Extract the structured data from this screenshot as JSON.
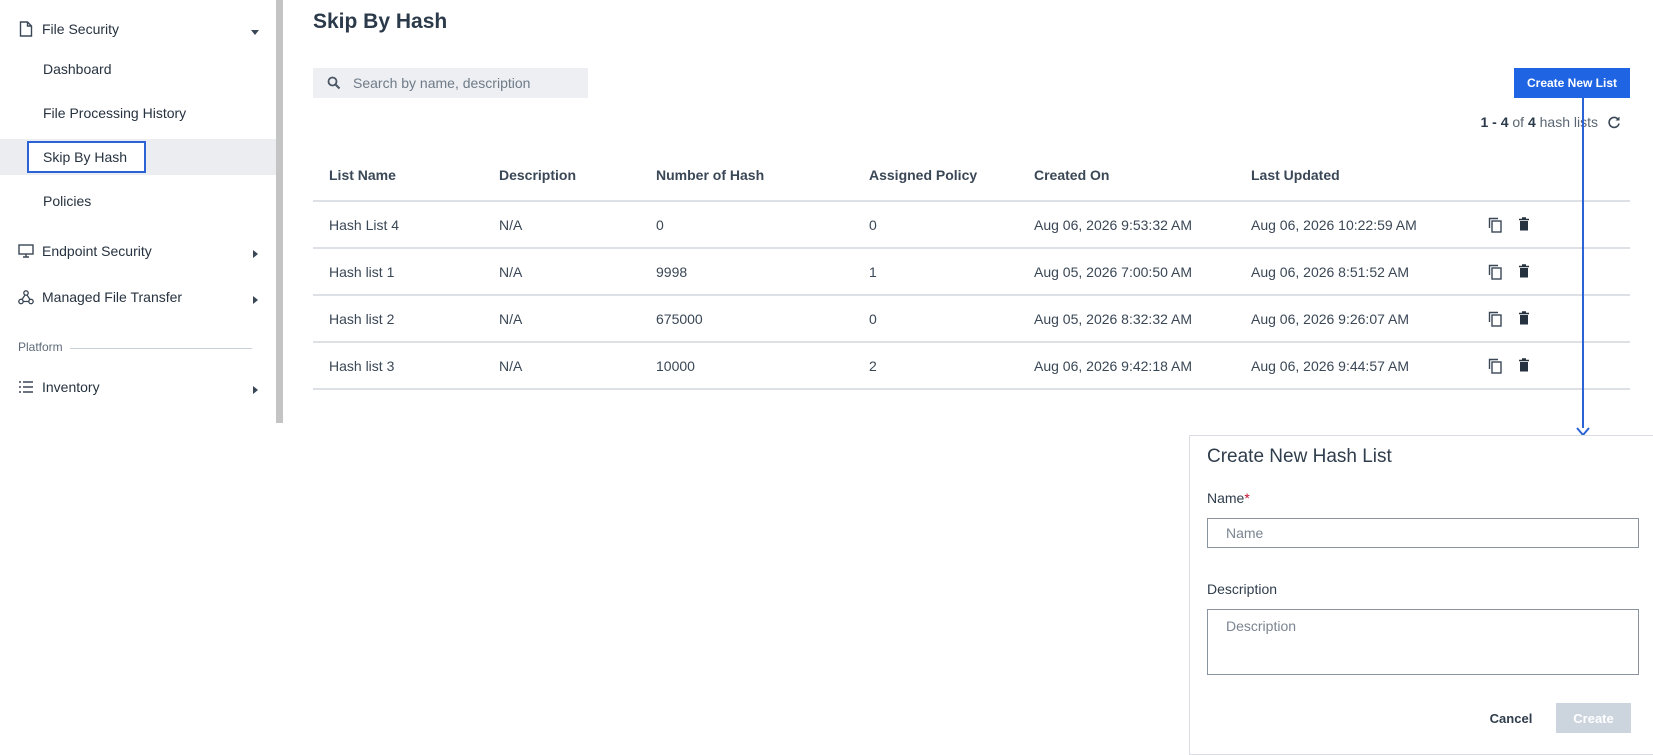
{
  "sidebar": {
    "file_security": {
      "label": "File Security",
      "icon": "file-icon"
    },
    "items": [
      {
        "label": "Dashboard"
      },
      {
        "label": "File Processing History"
      },
      {
        "label": "Skip By Hash",
        "active": true
      },
      {
        "label": "Policies"
      }
    ],
    "endpoint_security": {
      "label": "Endpoint Security",
      "icon": "monitor-icon"
    },
    "managed_file_transfer": {
      "label": "Managed File Transfer",
      "icon": "share-nodes-icon"
    },
    "section_platform": "Platform",
    "inventory": {
      "label": "Inventory",
      "icon": "list-icon"
    }
  },
  "main": {
    "title": "Skip By Hash",
    "search": {
      "placeholder": "Search by name, description",
      "value": ""
    },
    "create_button": "Create New List",
    "count": {
      "range": "1 - 4",
      "of_text": "of",
      "total": "4",
      "suffix": "hash lists"
    },
    "table": {
      "columns": [
        "List Name",
        "Description",
        "Number of Hash",
        "Assigned Policy",
        "Created On",
        "Last Updated",
        ""
      ],
      "rows": [
        {
          "name": "Hash List 4",
          "description": "N/A",
          "hash_count": "0",
          "policy": "0",
          "created": "Aug 06, 2026 9:53:32 AM",
          "updated": "Aug 06, 2026 10:22:59 AM"
        },
        {
          "name": "Hash list 1",
          "description": "N/A",
          "hash_count": "9998",
          "policy": "1",
          "created": "Aug 05, 2026 7:00:50 AM",
          "updated": "Aug 06, 2026 8:51:52 AM"
        },
        {
          "name": "Hash list 2",
          "description": "N/A",
          "hash_count": "675000",
          "policy": "0",
          "created": "Aug 05, 2026 8:32:32 AM",
          "updated": "Aug 06, 2026 9:26:07 AM"
        },
        {
          "name": "Hash list 3",
          "description": "N/A",
          "hash_count": "10000",
          "policy": "2",
          "created": "Aug 06, 2026 9:42:18 AM",
          "updated": "Aug 06, 2026 9:44:57 AM"
        }
      ]
    }
  },
  "dialog": {
    "title": "Create New Hash List",
    "name_label": "Name",
    "name_required_mark": "*",
    "name_placeholder": "Name",
    "description_label": "Description",
    "description_placeholder": "Description",
    "cancel": "Cancel",
    "create": "Create"
  },
  "colors": {
    "primary": "#1f65e3",
    "active_outline": "#2b63d6",
    "required": "#c8102e",
    "disabled_button": "#ccd4dd"
  }
}
